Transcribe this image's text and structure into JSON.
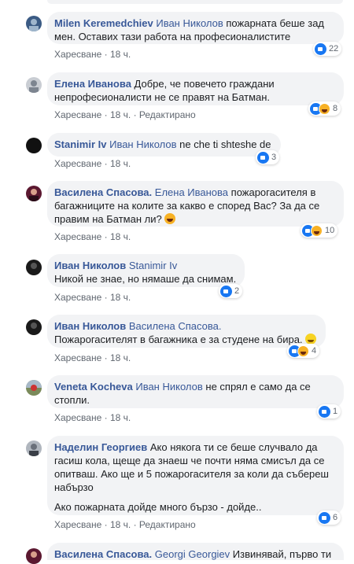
{
  "ui": {
    "like_label": "Харесване",
    "dot": "·",
    "edited_label": "Редактирано"
  },
  "comments": [
    {
      "author": "Milen Keremedchiev",
      "mention": "Иван Николов",
      "text": "пожарната беше зад мен. Оставих тази работа на професионалистите",
      "time": "18 ч.",
      "reactions": "22"
    },
    {
      "author": "Елена Иванова",
      "mention": "",
      "text": "Добре, че повечето граждани непрофесионалисти не се правят на Батман.",
      "time": "18 ч.",
      "edited": true,
      "reactions": "8"
    },
    {
      "author": "Stanimir Iv",
      "mention": "Иван Николов",
      "text": "ne che ti shteshe de",
      "time": "18 ч.",
      "reactions": "3"
    },
    {
      "author": "Василена Спасова.",
      "mention": "Елена Иванова",
      "text": "пожарогасителя в багажниците на колите за какво е според Вас? За да се правим на Батман ли?",
      "time": "18 ч.",
      "reactions": "10"
    },
    {
      "author": "Иван Николов",
      "mention": "Stanimir Iv",
      "text": "Никой не знае, но нямаше да снимам.",
      "time": "18 ч.",
      "reactions": "2"
    },
    {
      "author": "Иван Николов",
      "mention": "Василена Спасова.",
      "text": "Пожарогасителят в багажника е за студене на бира.",
      "time": "18 ч.",
      "reactions": "4"
    },
    {
      "author": "Veneta Kocheva",
      "mention": "Иван Николов",
      "text": "не спрял е само да се стопли.",
      "time": "18 ч.",
      "reactions": "1"
    },
    {
      "author": "Наделин Георгиев",
      "mention": "",
      "text": "Ако някога ти се беше случвало да гасиш кола, щеще да знаеш че почти няма смисъл да се опитваш. Ако ще и 5 пожарогасителя за коли да събереш набързо",
      "text2": "Ако пожарната дойде много бързо - дойде..",
      "time": "18 ч.",
      "edited": true,
      "reactions": "6"
    },
    {
      "author": "Василена Спасова.",
      "mention": "Georgi Georgiev",
      "text": "Извинявай, първо ти",
      "time": "",
      "reactions": ""
    }
  ],
  "colors": {
    "link": "#385898",
    "bubble": "#f2f3f5",
    "like_blue": "#1877f2",
    "haha": "#f7b125"
  }
}
